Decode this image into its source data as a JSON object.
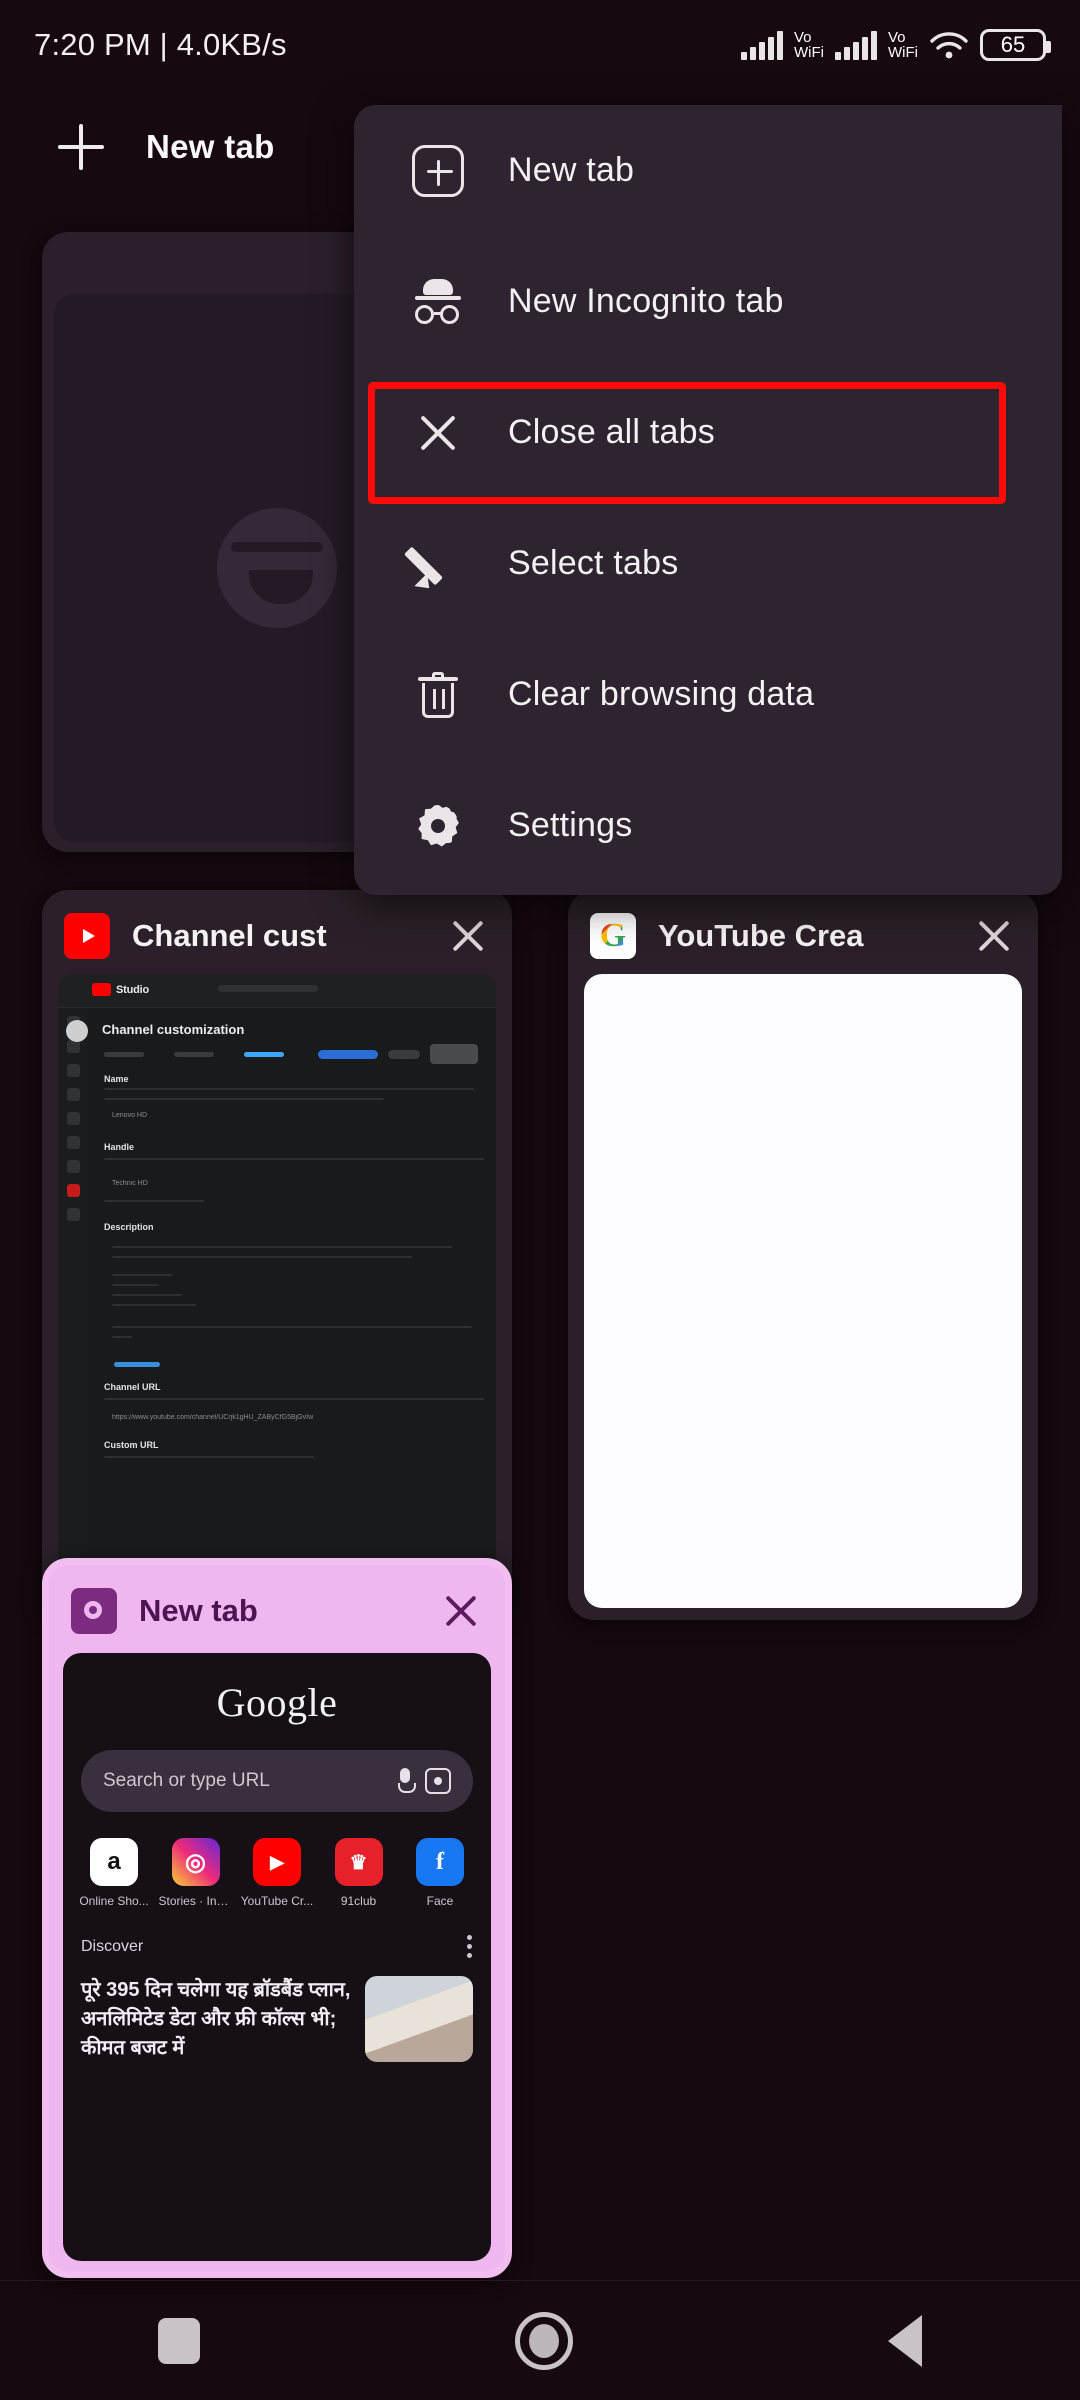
{
  "status_bar": {
    "left_text": "7:20 PM | 4.0KB/s",
    "signal_1_label": "Vo\nWiFi",
    "signal_2_label": "Vo\nWiFi",
    "battery_level": "65",
    "icons": [
      "signal-icon",
      "volte-wifi-icon",
      "signal-icon",
      "volte-wifi-icon",
      "wifi-icon",
      "battery-icon"
    ]
  },
  "toolbar": {
    "new_tab_label": "New tab",
    "plus_icon": "plus-icon"
  },
  "menu": {
    "items": [
      {
        "label": "New tab",
        "icon": "new-tab-icon"
      },
      {
        "label": "New Incognito tab",
        "icon": "incognito-icon"
      },
      {
        "label": "Close all tabs",
        "icon": "close-x-icon",
        "highlighted": true
      },
      {
        "label": "Select tabs",
        "icon": "pencil-icon"
      },
      {
        "label": "Clear browsing data",
        "icon": "trash-icon"
      },
      {
        "label": "Settings",
        "icon": "gear-icon"
      }
    ],
    "highlight_color": "#ff0a0a",
    "background_color": "#2e2430"
  },
  "tabs": [
    {
      "title": "",
      "favicon": "globe-icon",
      "selected": false
    },
    {
      "title": "Channel cust",
      "favicon": "youtube-icon",
      "selected": false,
      "thumbnail": {
        "brand": "Studio",
        "heading": "Channel customization",
        "section_name_label": "Name",
        "section_handle_label": "Handle",
        "section_desc_label": "Description",
        "channel_url_label": "Channel URL",
        "custom_url_label": "Custom URL",
        "url_value": "https://www.youtube.com/channel/UCrjk1gHU_ZAByCfG5BjGvIw"
      }
    },
    {
      "title": "YouTube Crea",
      "favicon": "google-icon",
      "selected": false
    },
    {
      "title": "New tab",
      "favicon": "chrome-icon",
      "selected": true,
      "ntp": {
        "logo_text": "Google",
        "search_placeholder": "Search or type URL",
        "mic_icon": "microphone-icon",
        "lens_icon": "google-lens-icon",
        "shortcuts": [
          {
            "name": "Online Sho...",
            "glyph": "a",
            "bg": "#ffffff",
            "fg": "#111111"
          },
          {
            "name": "Stories · Ins...",
            "glyph": "◎",
            "bg": "#d62976",
            "fg": "#ffffff"
          },
          {
            "name": "YouTube Cr...",
            "glyph": "▶",
            "bg": "#ff0000",
            "fg": "#ffffff"
          },
          {
            "name": "91club",
            "glyph": "♛",
            "bg": "#e6212a",
            "fg": "#ffffff"
          },
          {
            "name": "Face",
            "glyph": "f",
            "bg": "#1877f2",
            "fg": "#ffffff"
          }
        ],
        "discover_label": "Discover",
        "discover_menu_icon": "kebab-menu-icon",
        "article_headline": "पूरे 395 दिन चलेगा यह ब्रॉडबैंड प्लान, अनलिमिटेड डेटा और फ्री कॉल्स भी; कीमत बजट में"
      }
    }
  ],
  "nav_bar": {
    "recent_icon": "recent-apps-icon",
    "home_icon": "home-icon",
    "back_icon": "back-icon"
  }
}
